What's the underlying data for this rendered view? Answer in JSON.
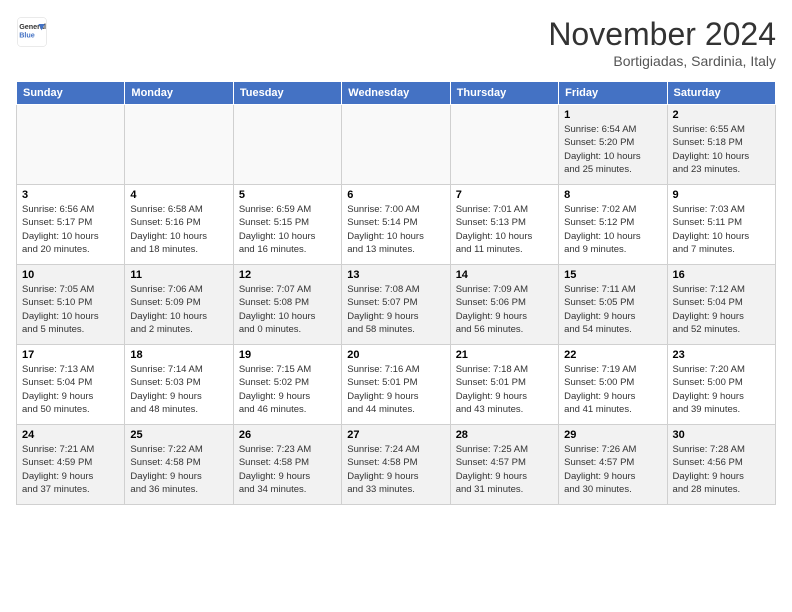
{
  "header": {
    "logo_line1": "General",
    "logo_line2": "Blue",
    "month": "November 2024",
    "location": "Bortigiadas, Sardinia, Italy"
  },
  "weekdays": [
    "Sunday",
    "Monday",
    "Tuesday",
    "Wednesday",
    "Thursday",
    "Friday",
    "Saturday"
  ],
  "weeks": [
    [
      {
        "day": "",
        "info": ""
      },
      {
        "day": "",
        "info": ""
      },
      {
        "day": "",
        "info": ""
      },
      {
        "day": "",
        "info": ""
      },
      {
        "day": "",
        "info": ""
      },
      {
        "day": "1",
        "info": "Sunrise: 6:54 AM\nSunset: 5:20 PM\nDaylight: 10 hours\nand 25 minutes."
      },
      {
        "day": "2",
        "info": "Sunrise: 6:55 AM\nSunset: 5:18 PM\nDaylight: 10 hours\nand 23 minutes."
      }
    ],
    [
      {
        "day": "3",
        "info": "Sunrise: 6:56 AM\nSunset: 5:17 PM\nDaylight: 10 hours\nand 20 minutes."
      },
      {
        "day": "4",
        "info": "Sunrise: 6:58 AM\nSunset: 5:16 PM\nDaylight: 10 hours\nand 18 minutes."
      },
      {
        "day": "5",
        "info": "Sunrise: 6:59 AM\nSunset: 5:15 PM\nDaylight: 10 hours\nand 16 minutes."
      },
      {
        "day": "6",
        "info": "Sunrise: 7:00 AM\nSunset: 5:14 PM\nDaylight: 10 hours\nand 13 minutes."
      },
      {
        "day": "7",
        "info": "Sunrise: 7:01 AM\nSunset: 5:13 PM\nDaylight: 10 hours\nand 11 minutes."
      },
      {
        "day": "8",
        "info": "Sunrise: 7:02 AM\nSunset: 5:12 PM\nDaylight: 10 hours\nand 9 minutes."
      },
      {
        "day": "9",
        "info": "Sunrise: 7:03 AM\nSunset: 5:11 PM\nDaylight: 10 hours\nand 7 minutes."
      }
    ],
    [
      {
        "day": "10",
        "info": "Sunrise: 7:05 AM\nSunset: 5:10 PM\nDaylight: 10 hours\nand 5 minutes."
      },
      {
        "day": "11",
        "info": "Sunrise: 7:06 AM\nSunset: 5:09 PM\nDaylight: 10 hours\nand 2 minutes."
      },
      {
        "day": "12",
        "info": "Sunrise: 7:07 AM\nSunset: 5:08 PM\nDaylight: 10 hours\nand 0 minutes."
      },
      {
        "day": "13",
        "info": "Sunrise: 7:08 AM\nSunset: 5:07 PM\nDaylight: 9 hours\nand 58 minutes."
      },
      {
        "day": "14",
        "info": "Sunrise: 7:09 AM\nSunset: 5:06 PM\nDaylight: 9 hours\nand 56 minutes."
      },
      {
        "day": "15",
        "info": "Sunrise: 7:11 AM\nSunset: 5:05 PM\nDaylight: 9 hours\nand 54 minutes."
      },
      {
        "day": "16",
        "info": "Sunrise: 7:12 AM\nSunset: 5:04 PM\nDaylight: 9 hours\nand 52 minutes."
      }
    ],
    [
      {
        "day": "17",
        "info": "Sunrise: 7:13 AM\nSunset: 5:04 PM\nDaylight: 9 hours\nand 50 minutes."
      },
      {
        "day": "18",
        "info": "Sunrise: 7:14 AM\nSunset: 5:03 PM\nDaylight: 9 hours\nand 48 minutes."
      },
      {
        "day": "19",
        "info": "Sunrise: 7:15 AM\nSunset: 5:02 PM\nDaylight: 9 hours\nand 46 minutes."
      },
      {
        "day": "20",
        "info": "Sunrise: 7:16 AM\nSunset: 5:01 PM\nDaylight: 9 hours\nand 44 minutes."
      },
      {
        "day": "21",
        "info": "Sunrise: 7:18 AM\nSunset: 5:01 PM\nDaylight: 9 hours\nand 43 minutes."
      },
      {
        "day": "22",
        "info": "Sunrise: 7:19 AM\nSunset: 5:00 PM\nDaylight: 9 hours\nand 41 minutes."
      },
      {
        "day": "23",
        "info": "Sunrise: 7:20 AM\nSunset: 5:00 PM\nDaylight: 9 hours\nand 39 minutes."
      }
    ],
    [
      {
        "day": "24",
        "info": "Sunrise: 7:21 AM\nSunset: 4:59 PM\nDaylight: 9 hours\nand 37 minutes."
      },
      {
        "day": "25",
        "info": "Sunrise: 7:22 AM\nSunset: 4:58 PM\nDaylight: 9 hours\nand 36 minutes."
      },
      {
        "day": "26",
        "info": "Sunrise: 7:23 AM\nSunset: 4:58 PM\nDaylight: 9 hours\nand 34 minutes."
      },
      {
        "day": "27",
        "info": "Sunrise: 7:24 AM\nSunset: 4:58 PM\nDaylight: 9 hours\nand 33 minutes."
      },
      {
        "day": "28",
        "info": "Sunrise: 7:25 AM\nSunset: 4:57 PM\nDaylight: 9 hours\nand 31 minutes."
      },
      {
        "day": "29",
        "info": "Sunrise: 7:26 AM\nSunset: 4:57 PM\nDaylight: 9 hours\nand 30 minutes."
      },
      {
        "day": "30",
        "info": "Sunrise: 7:28 AM\nSunset: 4:56 PM\nDaylight: 9 hours\nand 28 minutes."
      }
    ]
  ]
}
